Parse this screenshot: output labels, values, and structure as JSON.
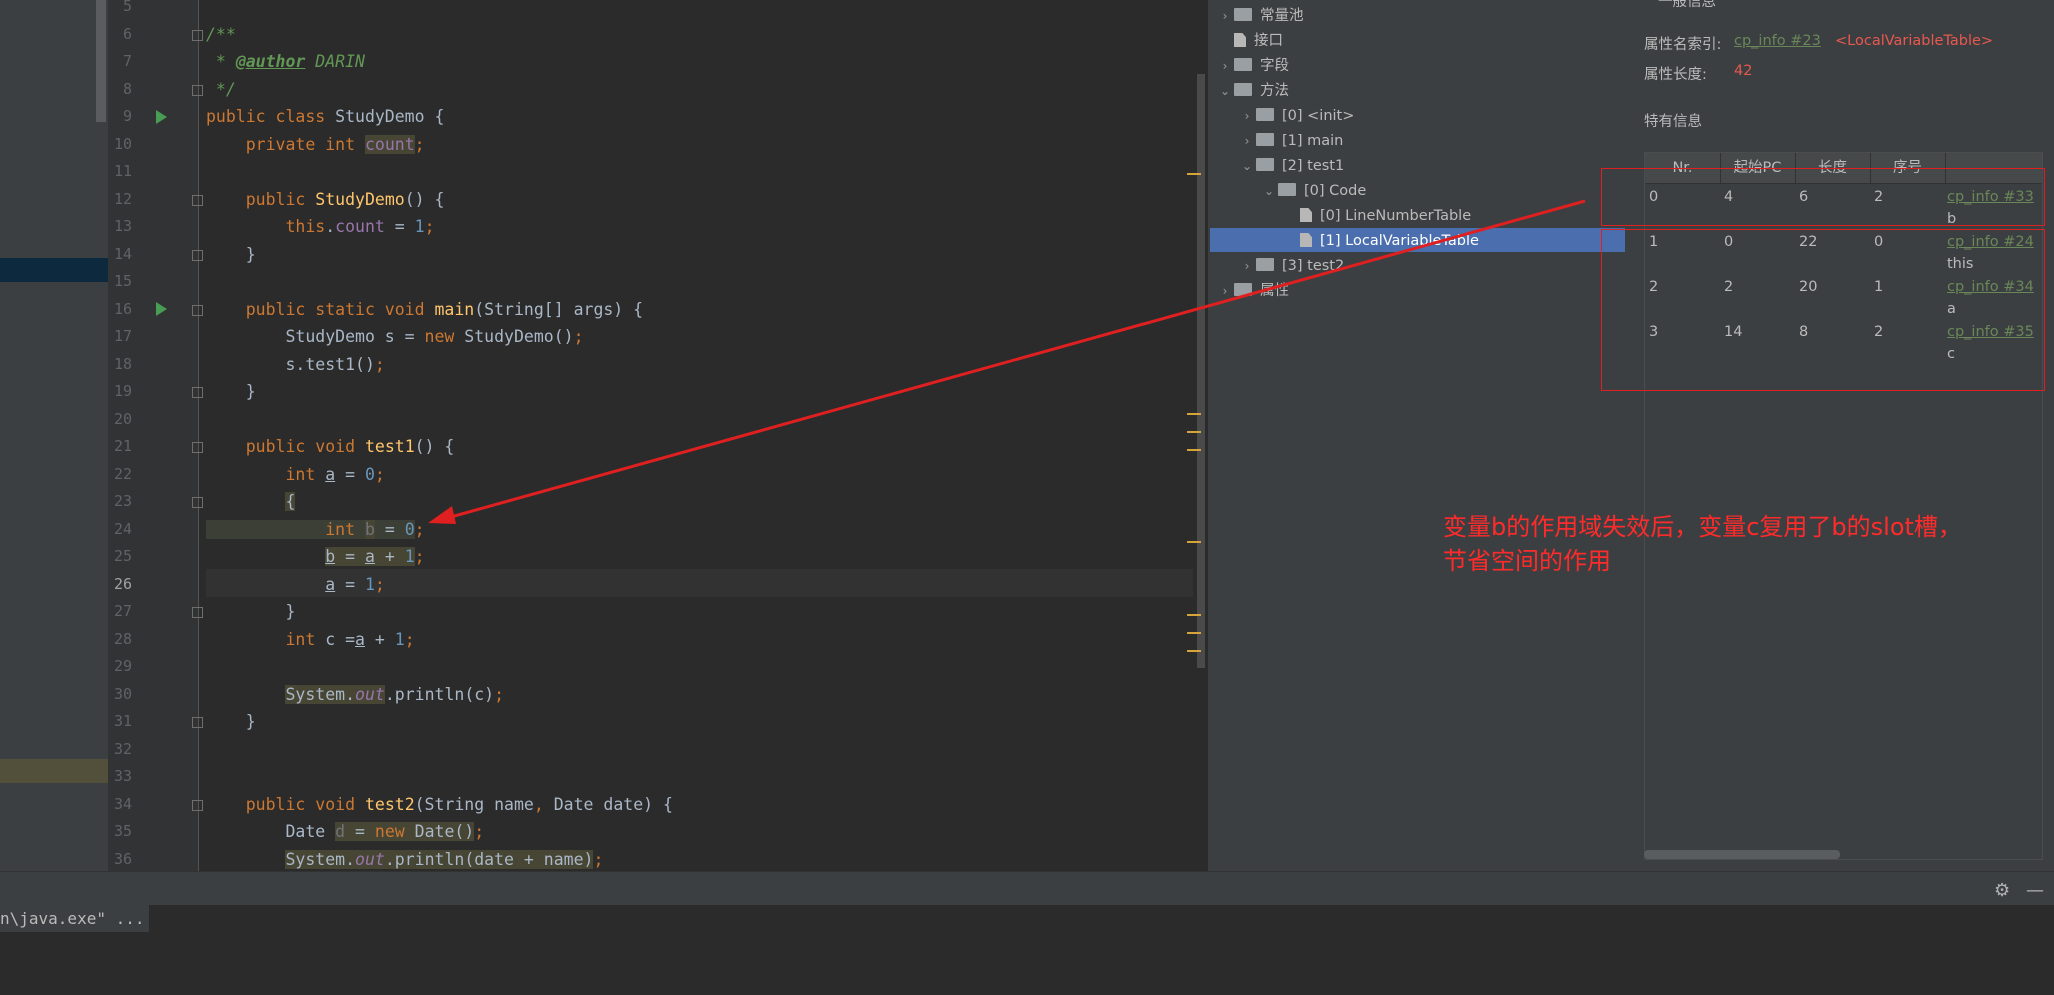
{
  "editor": {
    "lines": [
      {
        "n": "5",
        "tokens": []
      },
      {
        "n": "6",
        "tokens": [
          {
            "t": "/**",
            "c": "doc"
          }
        ]
      },
      {
        "n": "7",
        "tokens": [
          {
            "t": " * ",
            "c": "doc"
          },
          {
            "t": "@author",
            "c": "tag"
          },
          {
            "t": " DARIN",
            "c": "doc"
          }
        ]
      },
      {
        "n": "8",
        "tokens": [
          {
            "t": " */",
            "c": "doc"
          }
        ]
      },
      {
        "n": "9",
        "tokens": [
          {
            "t": "public class ",
            "c": "kw"
          },
          {
            "t": "StudyDemo {",
            "c": ""
          }
        ]
      },
      {
        "n": "10",
        "tokens": [
          {
            "t": "    private int ",
            "c": "kw"
          },
          {
            "t": "count",
            "c": "fld hlbg"
          },
          {
            "t": ";",
            "c": "kw"
          }
        ]
      },
      {
        "n": "11",
        "tokens": []
      },
      {
        "n": "12",
        "tokens": [
          {
            "t": "    public ",
            "c": "kw"
          },
          {
            "t": "StudyDemo",
            "c": "fn"
          },
          {
            "t": "() {",
            "c": ""
          }
        ]
      },
      {
        "n": "13",
        "tokens": [
          {
            "t": "        this",
            "c": "kw"
          },
          {
            "t": ".",
            "c": ""
          },
          {
            "t": "count",
            "c": "fld"
          },
          {
            "t": " = ",
            "c": ""
          },
          {
            "t": "1",
            "c": "num"
          },
          {
            "t": ";",
            "c": "kw"
          }
        ]
      },
      {
        "n": "14",
        "tokens": [
          {
            "t": "    }",
            "c": ""
          }
        ]
      },
      {
        "n": "15",
        "tokens": []
      },
      {
        "n": "16",
        "tokens": [
          {
            "t": "    public static void ",
            "c": "kw"
          },
          {
            "t": "main",
            "c": "fn"
          },
          {
            "t": "(String[] args) {",
            "c": ""
          }
        ]
      },
      {
        "n": "17",
        "tokens": [
          {
            "t": "        StudyDemo s = ",
            "c": ""
          },
          {
            "t": "new ",
            "c": "kw"
          },
          {
            "t": "StudyDemo()",
            "c": ""
          },
          {
            "t": ";",
            "c": "kw"
          }
        ]
      },
      {
        "n": "18",
        "tokens": [
          {
            "t": "        s.test1()",
            "c": ""
          },
          {
            "t": ";",
            "c": "kw"
          }
        ]
      },
      {
        "n": "19",
        "tokens": [
          {
            "t": "    }",
            "c": ""
          }
        ]
      },
      {
        "n": "20",
        "tokens": []
      },
      {
        "n": "21",
        "tokens": [
          {
            "t": "    public void ",
            "c": "kw"
          },
          {
            "t": "test1",
            "c": "fn"
          },
          {
            "t": "() {",
            "c": ""
          }
        ]
      },
      {
        "n": "22",
        "tokens": [
          {
            "t": "        int ",
            "c": "kw"
          },
          {
            "t": "a",
            "c": "ul"
          },
          {
            "t": " = ",
            "c": ""
          },
          {
            "t": "0",
            "c": "num"
          },
          {
            "t": ";",
            "c": "kw"
          }
        ]
      },
      {
        "n": "23",
        "tokens": [
          {
            "t": "        ",
            "c": ""
          },
          {
            "t": "{",
            "c": "hlbg"
          }
        ]
      },
      {
        "n": "24",
        "tokens": [
          {
            "t": "            int ",
            "c": "kw mark"
          },
          {
            "t": "b",
            "c": "unused hlbg"
          },
          {
            "t": " = ",
            "c": "mark"
          },
          {
            "t": "0",
            "c": "num mark"
          },
          {
            "t": ";",
            "c": "kw"
          }
        ]
      },
      {
        "n": "25",
        "tokens": [
          {
            "t": "            ",
            "c": ""
          },
          {
            "t": "b",
            "c": "ul hlbg"
          },
          {
            "t": " = ",
            "c": "hlbg"
          },
          {
            "t": "a",
            "c": "ul hlbg"
          },
          {
            "t": " + ",
            "c": "hlbg"
          },
          {
            "t": "1",
            "c": "num hlbg"
          },
          {
            "t": ";",
            "c": "kw"
          }
        ]
      },
      {
        "n": "26",
        "tokens": [
          {
            "t": "            ",
            "c": ""
          },
          {
            "t": "a",
            "c": "ul"
          },
          {
            "t": " = ",
            "c": ""
          },
          {
            "t": "1",
            "c": "num"
          },
          {
            "t": ";",
            "c": "kw"
          }
        ]
      },
      {
        "n": "27",
        "tokens": [
          {
            "t": "        }",
            "c": ""
          }
        ]
      },
      {
        "n": "28",
        "tokens": [
          {
            "t": "        int ",
            "c": "kw"
          },
          {
            "t": "c =",
            "c": ""
          },
          {
            "t": "a",
            "c": "ul"
          },
          {
            "t": " + ",
            "c": ""
          },
          {
            "t": "1",
            "c": "num"
          },
          {
            "t": ";",
            "c": "kw"
          }
        ]
      },
      {
        "n": "29",
        "tokens": []
      },
      {
        "n": "30",
        "tokens": [
          {
            "t": "        ",
            "c": ""
          },
          {
            "t": "System.",
            "c": "hlbg"
          },
          {
            "t": "out",
            "c": "fld it hlbg"
          },
          {
            "t": ".println(c)",
            "c": ""
          },
          {
            "t": ";",
            "c": "kw"
          }
        ]
      },
      {
        "n": "31",
        "tokens": [
          {
            "t": "    }",
            "c": ""
          }
        ]
      },
      {
        "n": "32",
        "tokens": []
      },
      {
        "n": "33",
        "tokens": []
      },
      {
        "n": "34",
        "tokens": [
          {
            "t": "    public void ",
            "c": "kw"
          },
          {
            "t": "test2",
            "c": "fn"
          },
          {
            "t": "(String name",
            "c": ""
          },
          {
            "t": ", ",
            "c": "kw"
          },
          {
            "t": "Date date) {",
            "c": ""
          }
        ]
      },
      {
        "n": "35",
        "tokens": [
          {
            "t": "        Date ",
            "c": ""
          },
          {
            "t": "d",
            "c": "unused hlbg"
          },
          {
            "t": " = ",
            "c": "hlbg"
          },
          {
            "t": "new ",
            "c": "kw hlbg"
          },
          {
            "t": "Date()",
            "c": "hlbg"
          },
          {
            "t": ";",
            "c": "kw"
          }
        ]
      },
      {
        "n": "36",
        "tokens": [
          {
            "t": "        ",
            "c": ""
          },
          {
            "t": "System.",
            "c": "hlbg"
          },
          {
            "t": "out",
            "c": "fld it hlbg"
          },
          {
            "t": ".println(date + name)",
            "c": "hlbg"
          },
          {
            "t": ";",
            "c": "kw"
          }
        ]
      }
    ],
    "current_line": "26"
  },
  "tree": {
    "items": [
      {
        "label": "常量池",
        "depth": 0,
        "arrow": "›",
        "icon": "folder"
      },
      {
        "label": "接口",
        "depth": 0,
        "arrow": "",
        "icon": "file"
      },
      {
        "label": "字段",
        "depth": 0,
        "arrow": "›",
        "icon": "folder"
      },
      {
        "label": "方法",
        "depth": 0,
        "arrow": "⌄",
        "icon": "folder"
      },
      {
        "label": "[0] <init>",
        "depth": 1,
        "arrow": "›",
        "icon": "folder"
      },
      {
        "label": "[1] main",
        "depth": 1,
        "arrow": "›",
        "icon": "folder"
      },
      {
        "label": "[2] test1",
        "depth": 1,
        "arrow": "⌄",
        "icon": "folder"
      },
      {
        "label": "[0] Code",
        "depth": 2,
        "arrow": "⌄",
        "icon": "folder"
      },
      {
        "label": "[0] LineNumberTable",
        "depth": 3,
        "arrow": "",
        "icon": "file"
      },
      {
        "label": "[1] LocalVariableTable",
        "depth": 3,
        "arrow": "",
        "icon": "file"
      },
      {
        "label": "[3] test2",
        "depth": 1,
        "arrow": "›",
        "icon": "folder"
      },
      {
        "label": "属性",
        "depth": 0,
        "arrow": "›",
        "icon": "folder"
      }
    ],
    "selected_index": 9
  },
  "info": {
    "top_cut_label": "一般信息",
    "attr_name_index_label": "属性名索引:",
    "attr_name_index_link": "cp_info #23",
    "attr_name_index_value": "<LocalVariableTable>",
    "attr_length_label": "属性长度:",
    "attr_length_value": "42",
    "specific_info_label": "特有信息",
    "table": {
      "headers": [
        "Nr.",
        "起始PC",
        "长度",
        "序号",
        ""
      ],
      "rows": [
        {
          "nr": "0",
          "start": "4",
          "len": "6",
          "idx": "2",
          "link": "cp_info #33",
          "name": "b"
        },
        {
          "nr": "1",
          "start": "0",
          "len": "22",
          "idx": "0",
          "link": "cp_info #24",
          "name": "this"
        },
        {
          "nr": "2",
          "start": "2",
          "len": "20",
          "idx": "1",
          "link": "cp_info #34",
          "name": "a"
        },
        {
          "nr": "3",
          "start": "14",
          "len": "8",
          "idx": "2",
          "link": "cp_info #35",
          "name": "c"
        }
      ]
    }
  },
  "annotation": {
    "line1": "变量b的作用域失效后，变量c复用了b的slot槽，",
    "line2": "节省空间的作用",
    "color": "#ff2b2b"
  },
  "console": {
    "command": "n\\java.exe\" ..."
  },
  "colors": {
    "keyword": "#cc7832",
    "number": "#6897bb",
    "doc": "#629755",
    "function": "#ffc66d",
    "field": "#9876aa",
    "selection": "#4b6eaf"
  }
}
